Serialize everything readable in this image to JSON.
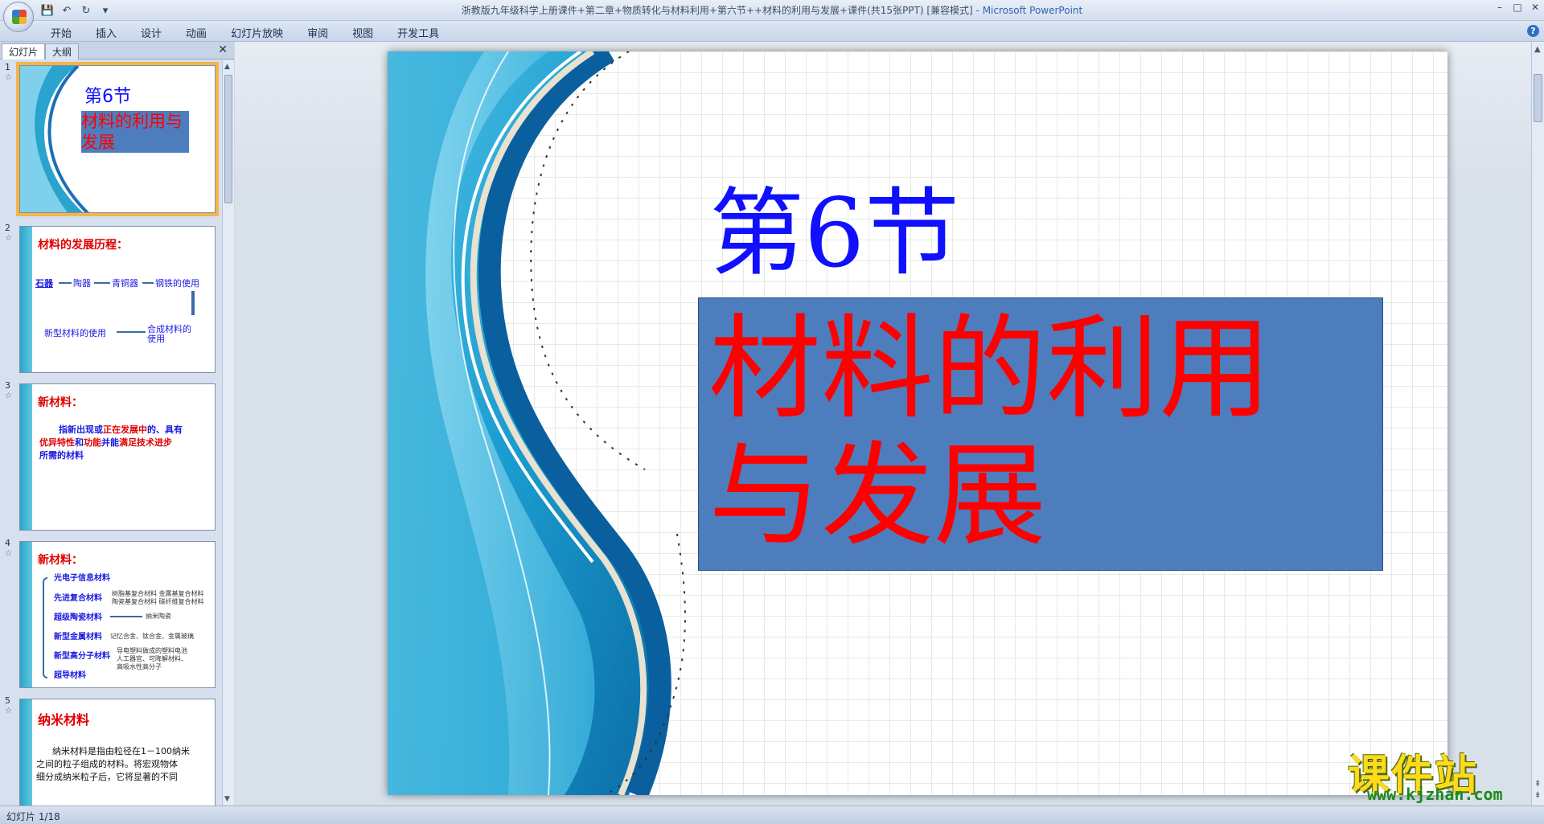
{
  "window": {
    "title": "浙教版九年级科学上册课件+第二章+物质转化与材料利用+第六节++材料的利用与发展+课件(共15张PPT) [兼容模式]",
    "app_name": "- Microsoft PowerPoint",
    "controls": {
      "minimize": "–",
      "maximize": "□",
      "close": "✕"
    }
  },
  "quick_access": {
    "save": "💾",
    "undo": "↶",
    "redo": "↻",
    "customize": "▾"
  },
  "ribbon": {
    "tabs": [
      "开始",
      "插入",
      "设计",
      "动画",
      "幻灯片放映",
      "审阅",
      "视图",
      "开发工具"
    ],
    "help": "?"
  },
  "left_pane": {
    "tabs": {
      "slides": "幻灯片",
      "outline": "大纲"
    },
    "close": "✕",
    "thumbnails": {
      "t1": {
        "num": "1",
        "heading": "第6节",
        "title": "材料的利用与发展"
      },
      "t2": {
        "num": "2",
        "title": "材料的发展历程：",
        "nodes": [
          "石器",
          "陶器",
          "青铜器",
          "钢铁的使用",
          "合成材料的使用",
          "新型材料的使用"
        ]
      },
      "t3": {
        "num": "3",
        "title": "新材料：",
        "line1_a": "指新出现或",
        "line1_b": "正在发展中",
        "line1_c": "的、具有",
        "line2_a": "优异特性",
        "line2_b": "和",
        "line2_c": "功能",
        "line2_d": "并能",
        "line2_e": "满足技术进步",
        "line3": "所需的材料"
      },
      "t4": {
        "num": "4",
        "title": "新材料：",
        "items": [
          "光电子信息材料",
          "先进复合材料",
          "超级陶瓷材料",
          "新型金属材料",
          "新型高分子材料",
          "超导材料"
        ],
        "notes": [
          "树脂基复合材料  金属基复合材料",
          "陶瓷基复合材料  碳纤维复合材料",
          "纳米陶瓷",
          "记忆合金、钛合金、金属玻璃",
          "导电塑料做成的塑料电池",
          "人工器官、可降解材料、",
          "高吸水性高分子"
        ]
      },
      "t5": {
        "num": "5",
        "title": "纳米材料",
        "line1": "纳米材料是指由粒径在1－100纳米",
        "line2": "之间的粒子组成的材料。将宏观物体",
        "line3": "细分成纳米粒子后，它将显著的不同"
      }
    },
    "band_label": "物质转化与材料利用"
  },
  "slide": {
    "heading": "第6节",
    "title": "材料的利用与发展"
  },
  "watermark": {
    "name": "课件站",
    "url": "www.kjzhan.com"
  },
  "status": {
    "slide_counter": "幻灯片 1/18"
  },
  "colors": {
    "title_blue": "#1010ff",
    "title_red": "#ff0000",
    "box_fill": "#4e7dbe",
    "selection": "#f4b54a"
  }
}
